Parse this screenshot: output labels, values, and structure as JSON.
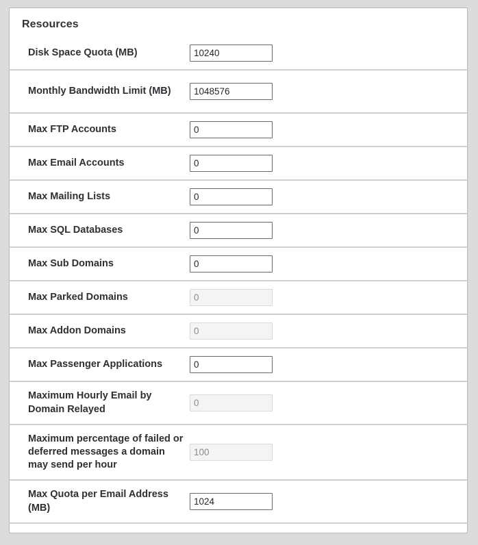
{
  "panel": {
    "title": "Resources"
  },
  "rows": [
    {
      "label": "Disk Space Quota (MB)",
      "value": "10240",
      "disabled": false
    },
    {
      "label": "Monthly Bandwidth Limit (MB)",
      "value": "1048576",
      "disabled": false
    },
    {
      "label": "Max FTP Accounts",
      "value": "0",
      "disabled": false
    },
    {
      "label": "Max Email Accounts",
      "value": "0",
      "disabled": false
    },
    {
      "label": "Max Mailing Lists",
      "value": "0",
      "disabled": false
    },
    {
      "label": "Max SQL Databases",
      "value": "0",
      "disabled": false
    },
    {
      "label": "Max Sub Domains",
      "value": "0",
      "disabled": false
    },
    {
      "label": "Max Parked Domains",
      "value": "0",
      "disabled": true
    },
    {
      "label": "Max Addon Domains",
      "value": "0",
      "disabled": true
    },
    {
      "label": "Max Passenger Applications",
      "value": "0",
      "disabled": false
    },
    {
      "label": "Maximum Hourly Email by Domain Relayed",
      "value": "0",
      "disabled": true
    },
    {
      "label": "Maximum percentage of failed or deferred messages a domain may send per hour",
      "value": "100",
      "disabled": true
    },
    {
      "label": "Max Quota per Email Address (MB)",
      "value": "1024",
      "disabled": false
    }
  ],
  "colors": {
    "page_background": "#dcdcdc",
    "panel_background": "#ffffff",
    "panel_border": "#b9b9b9",
    "divider": "#cfcfcf",
    "label_text": "#2d3035",
    "title_text": "#333333",
    "input_border": "#6a6a6a",
    "input_disabled_background": "#f4f4f4",
    "input_disabled_border": "#d9d9d9",
    "input_disabled_text": "#8a8a8a"
  }
}
